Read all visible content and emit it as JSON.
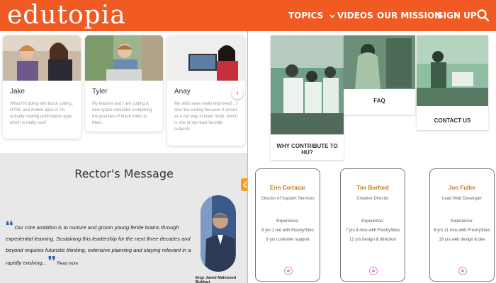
{
  "header": {
    "logo": "edutopia",
    "nav": {
      "topics": "TOPICS",
      "videos": "VIDEOS",
      "mission": "OUR MISSION",
      "signup": "SIGN UP"
    },
    "brand_color": "#f15a22"
  },
  "cards": [
    {
      "name": "Jake",
      "text": "What I'm doing with block coding, HTML and mobile apps is I'm actually making publishable apps which is really cool!"
    },
    {
      "name": "Tyler",
      "text": "My teacher and I are coding a new space simulator comparing the gravities of black holes to Mars."
    },
    {
      "name": "Anay",
      "text": "My skills have really improved! ...I also like coding because it serves as a fun way to learn math, which is one of my least favorite subjects."
    }
  ],
  "rector": {
    "title": "Rector's Message",
    "quote": "Our core ambition is to nurture and groom young fertile brains through experiential learning. Sustaining this leadership for the next three decades and beyond requires futuristic thinking, extensive planning and staying relevant in a rapidly evolving...",
    "read_more": "Read more",
    "name": "Engr Javed Mahmood Bukhari"
  },
  "tiles": {
    "contribute": "WHY CONTRIBUTE TO HU?",
    "faq": "FAQ",
    "contact": "CONTACT US"
  },
  "team": [
    {
      "name": "Erin Cortazar",
      "role": "Director of Support Services",
      "exp_label": "Experience:",
      "line1": "8 yrs 1 mo with FreshySites",
      "line2": "9 yrs customer support"
    },
    {
      "name": "Tim Burford",
      "role": "Creative Director",
      "exp_label": "Experience:",
      "line1": "7 yrs 4 mos with FreshySites",
      "line2": "12 yrs design & direction"
    },
    {
      "name": "Jon Fuller",
      "role": "Lead Web Developer",
      "exp_label": "Experience:",
      "line1": "6 yrs 11 mos with FreshySites",
      "line2": "19 yrs web design & dev"
    }
  ]
}
